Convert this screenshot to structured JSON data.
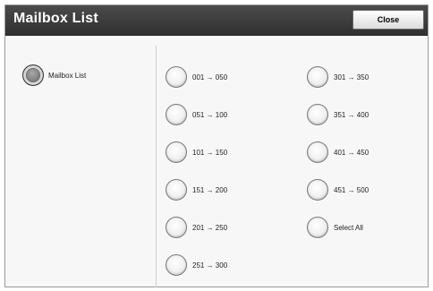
{
  "window": {
    "title": "Mailbox List",
    "close_label": "Close"
  },
  "mode": {
    "label": "Mailbox List",
    "selected": true
  },
  "ranges_left": [
    {
      "label": "001 → 050"
    },
    {
      "label": "051 → 100"
    },
    {
      "label": "101 → 150"
    },
    {
      "label": "151 → 200"
    },
    {
      "label": "201 → 250"
    },
    {
      "label": "251 → 300"
    }
  ],
  "ranges_right": [
    {
      "label": "301 → 350"
    },
    {
      "label": "351 → 400"
    },
    {
      "label": "401 → 450"
    },
    {
      "label": "451 → 500"
    },
    {
      "label": "Select All"
    }
  ]
}
